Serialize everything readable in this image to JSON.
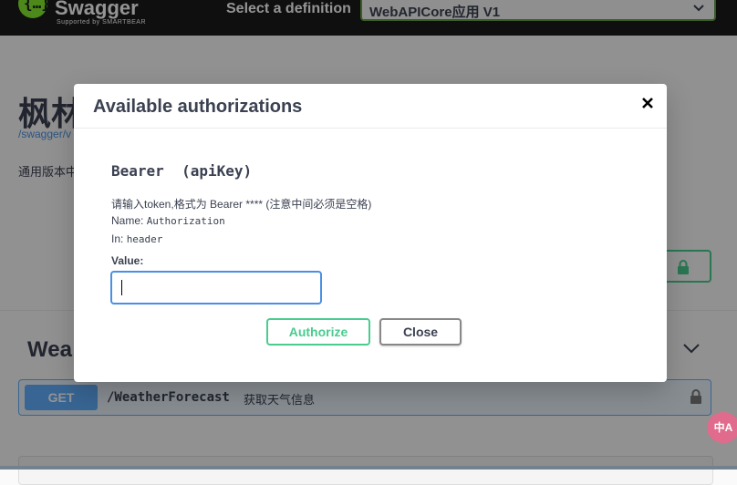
{
  "topbar": {
    "logo_text": "Swagger",
    "logo_sub": "Supported by SMARTBEAR",
    "select_label": "Select a definition",
    "definition_value": "WebAPICore应用 V1"
  },
  "page": {
    "title": "枫林",
    "link": "/swagger/v",
    "desc": "通用版本中"
  },
  "section": {
    "title": "Wea"
  },
  "operation": {
    "method": "GET",
    "path": "/WeatherForecast",
    "summary": "获取天气信息"
  },
  "ime": {
    "label": "中A"
  },
  "modal": {
    "title": "Available authorizations",
    "scheme_name": "Bearer  (apiKey)",
    "description": "请输入token,格式为 Bearer **** (注意中间必须是空格)",
    "name_label": "Name:",
    "name_value": "Authorization",
    "in_label": "In:",
    "in_value": "header",
    "value_label": "Value:",
    "value_input": "",
    "authorize_label": "Authorize",
    "close_label": "Close"
  },
  "colors": {
    "topbar": "#1b1b1b",
    "logo_green": "#85ea2d",
    "authorize_green": "#49cc90",
    "get_blue": "#61affe",
    "input_focus": "#4a90e2"
  }
}
